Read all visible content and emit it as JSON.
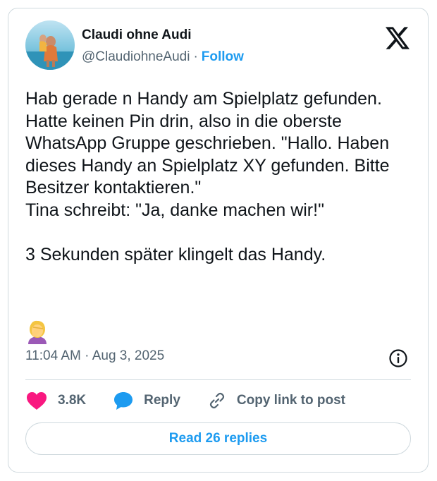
{
  "author": {
    "display_name": "Claudi ohne Audi",
    "handle": "@ClaudiohneAudi",
    "separator": "·",
    "follow_label": "Follow"
  },
  "platform_icon": "x-logo-icon",
  "post": {
    "text": "Hab gerade n Handy am Spielplatz gefunden. Hatte keinen Pin drin, also in die oberste WhatsApp Gruppe geschrieben. \"Hallo. Haben dieses Handy an Spielplatz XY gefunden. Bitte Besitzer kontaktieren.\"\nTina schreibt: \"Ja, danke machen wir!\"\n\n3 Sekunden später klingelt das Handy.",
    "emoji": "woman-facepalming-emoji",
    "timestamp": "11:04 AM · Aug 3, 2025"
  },
  "actions": {
    "like_count": "3.8K",
    "reply_label": "Reply",
    "copy_link_label": "Copy link to post",
    "read_replies_label": "Read 26 replies"
  },
  "colors": {
    "accent": "#1d9bf0",
    "like": "#f91880",
    "text": "#0f1419",
    "muted": "#536471",
    "border": "#cfd9de"
  }
}
